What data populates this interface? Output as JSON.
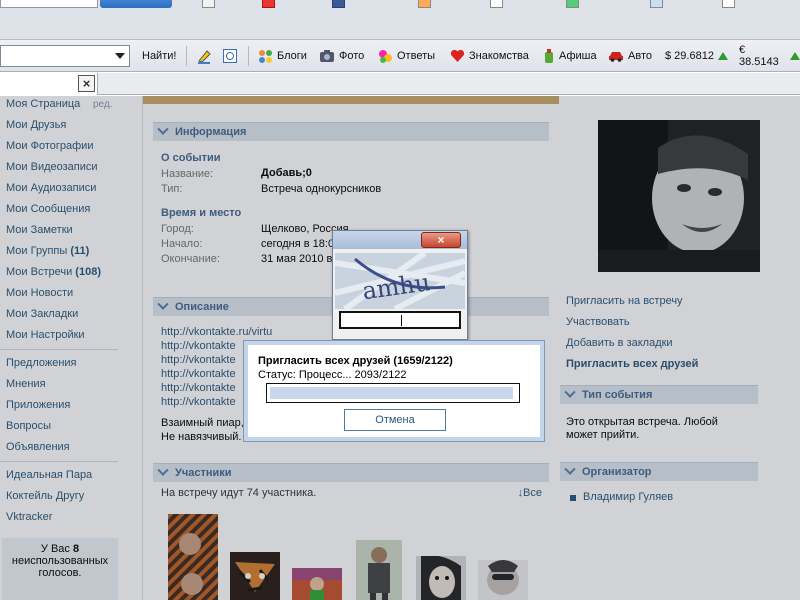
{
  "browser": {
    "toolbar": {
      "find_button": "Найти!",
      "links": [
        "Блоги",
        "Фото",
        "Ответы",
        "Знакомства",
        "Афиша",
        "Авто"
      ],
      "currency": [
        {
          "label": "$ 29.6812"
        },
        {
          "label": "€ 38.5143"
        }
      ]
    }
  },
  "nav": {
    "items": [
      {
        "label": "Моя Страница",
        "edit": "ред."
      },
      {
        "label": "Мои Друзья"
      },
      {
        "label": "Мои Фотографии"
      },
      {
        "label": "Мои Видеозаписи"
      },
      {
        "label": "Мои Аудиозаписи"
      },
      {
        "label": "Мои Сообщения"
      },
      {
        "label": "Мои Заметки"
      },
      {
        "label": "Мои Группы",
        "count": "(11)"
      },
      {
        "label": "Мои Встречи",
        "count": "(108)"
      },
      {
        "label": "Мои Новости"
      },
      {
        "label": "Мои Закладки"
      },
      {
        "label": "Мои Настройки"
      }
    ],
    "items2": [
      "Предложения",
      "Мнения",
      "Приложения",
      "Вопросы",
      "Объявления"
    ],
    "items3": [
      "Идеальная Пара",
      "Коктейль Другу",
      "Vktracker"
    ],
    "votes_box": {
      "line1": "У Вас",
      "count": "8",
      "line2": "неиспользованных",
      "line3": "голосов."
    }
  },
  "main": {
    "info_header": "Информация",
    "about_title": "О событии",
    "name_label": "Название:",
    "name_value": "Добавь;0",
    "type_label": "Тип:",
    "type_value": "Встреча однокурсников",
    "time_title": "Время и место",
    "city_label": "Город:",
    "city_value": "Щелково, Россия",
    "start_label": "Начало:",
    "start_value": "сегодня в 18:0",
    "end_label": "Окончание:",
    "end_value": "31 мая 2010 в",
    "desc_header": "Описание",
    "desc_links": [
      "http://vkontakte.ru/virtu",
      "http://vkontakte",
      "http://vkontakte",
      "http://vkontakte",
      "http://vkontakte",
      "http://vkontakte"
    ],
    "desc_text1": "Взаимный пиар,",
    "desc_text2": "Не навязчивый.",
    "members_header": "Участники",
    "members_count": "На встречу идут 74 участника.",
    "members_all": "↓Все"
  },
  "right": {
    "links": [
      "Пригласить на встречу",
      "Участвовать",
      "Добавить в закладки"
    ],
    "invite_all": "Пригласить всех друзей",
    "type_header": "Тип события",
    "type_text": "Это открытая встреча. Любой может прийти.",
    "org_header": "Организатор",
    "org_name": "Владимир Гуляев"
  },
  "captcha": {
    "close_label": "×",
    "text": "amhu",
    "input_value": ""
  },
  "progress": {
    "title": "Пригласить всех друзей (1659/2122)",
    "status": "Статус: Процесс... 2093/2122",
    "fraction": 0.986,
    "cancel": "Отмена"
  }
}
